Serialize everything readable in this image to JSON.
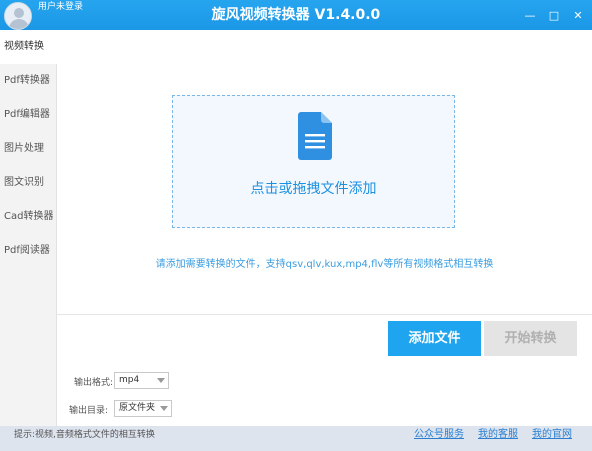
{
  "titlebar": {
    "user_label": "用户未登录",
    "title": "旋风视频转换器 V1.4.0.0",
    "controls": {
      "minimize": "—",
      "restore": "□",
      "close": "✕"
    }
  },
  "sidebar": {
    "items": [
      {
        "label": "视频转换",
        "active": true
      },
      {
        "label": "Pdf转换器"
      },
      {
        "label": "Pdf编辑器"
      },
      {
        "label": "图片处理"
      },
      {
        "label": "图文识别"
      },
      {
        "label": "Cad转换器"
      },
      {
        "label": "Pdf阅读器"
      }
    ]
  },
  "dropzone": {
    "text": "点击或拖拽文件添加",
    "icon": "document-icon"
  },
  "hint": "请添加需要转换的文件，支持qsv,qlv,kux,mp4,flv等所有视频格式相互转换",
  "buttons": {
    "add": "添加文件",
    "start": "开始转换"
  },
  "output": {
    "format_label": "输出格式:",
    "format_value": "mp4",
    "dir_label": "输出目录:",
    "dir_value": "原文件夹"
  },
  "statusbar": {
    "hint": "提示:视频,音频格式文件的相互转换",
    "links": [
      "公众号服务",
      "我的客服",
      "我的官网"
    ]
  },
  "colors": {
    "accent": "#1fa5ef",
    "title_bg": "#1b97e6",
    "link": "#2a7fd0"
  }
}
